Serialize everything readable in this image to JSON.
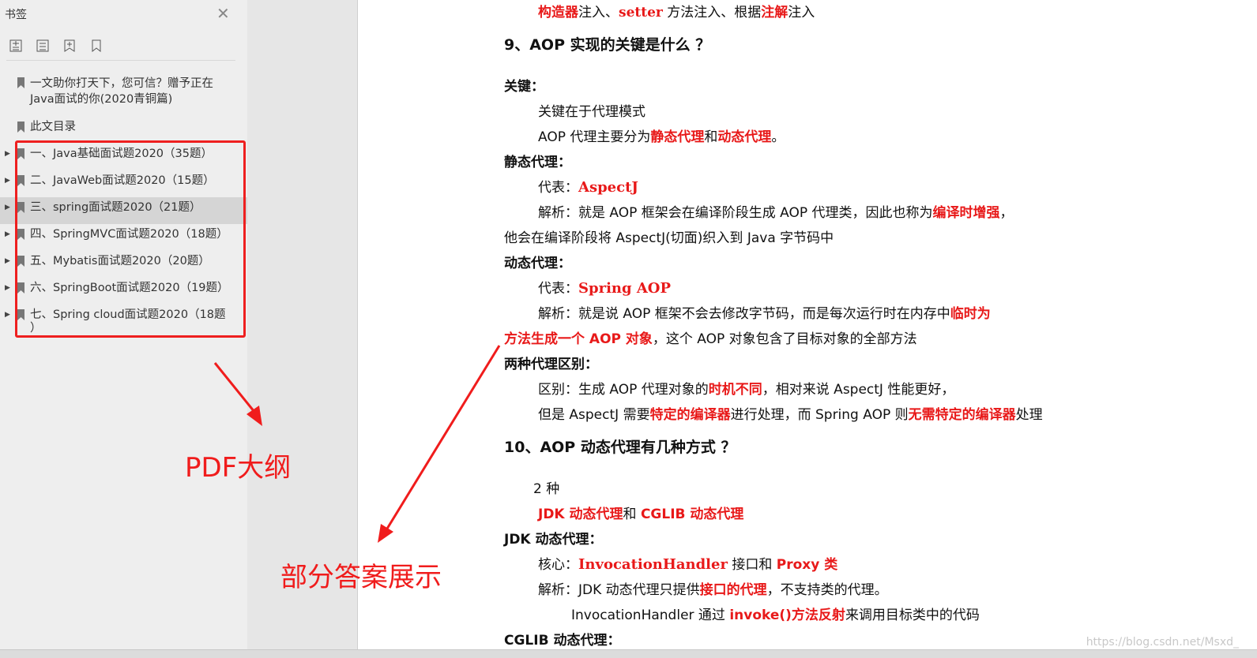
{
  "sidebar": {
    "title": "书签",
    "tools": [
      "expand-all-icon",
      "collapse-all-icon",
      "add-bookmark-icon",
      "bookmark-icon"
    ],
    "items": [
      {
        "label": "一文助你打天下，您可信？赠予正在Java面试的你(2020青铜篇)",
        "has_arrow": false
      },
      {
        "label": "此文目录",
        "has_arrow": false
      },
      {
        "label": "一、Java基础面试题2020（35题）",
        "has_arrow": true
      },
      {
        "label": "二、JavaWeb面试题2020（15题）",
        "has_arrow": true
      },
      {
        "label": "三、spring面试题2020（21题）",
        "has_arrow": true
      },
      {
        "label": "四、SpringMVC面试题2020（18题）",
        "has_arrow": true
      },
      {
        "label": "五、Mybatis面试题2020（20题）",
        "has_arrow": true
      },
      {
        "label": "六、SpringBoot面试题2020（19题）",
        "has_arrow": true
      },
      {
        "label": "七、Spring cloud面试题2020（18题",
        "label_cont": "）",
        "has_arrow": true
      }
    ]
  },
  "annotations": {
    "outline": "PDF大纲",
    "answers": "部分答案展示"
  },
  "doc": {
    "l0a": "构造器",
    "l0b": "注入、",
    "l0c": "setter",
    "l0d": " 方法注入、根据",
    "l0e": "注解",
    "l0f": "注入",
    "q9": "9、AOP 实现的关键是什么 ？",
    "key_h": "关键：",
    "key1": "关键在于代理模式",
    "key2a": "AOP 代理主要分为",
    "key2b": "静态代理",
    "key2c": "和",
    "key2d": "动态代理",
    "key2e": "。",
    "static_h": "静态代理：",
    "s_rep_a": "代表：",
    "s_rep_b": "AspectJ",
    "s_ana_a": "解析：就是 AOP 框架会在编译阶段生成 AOP 代理类，因此也称为",
    "s_ana_b": "编译时增强",
    "s_ana_c": "，",
    "s_ana2": "他会在编译阶段将 AspectJ(切面)织入到 Java 字节码中",
    "dyn_h": "动态代理：",
    "d_rep_a": "代表：",
    "d_rep_b": "Spring AOP",
    "d_ana_a": "解析：就是说 AOP 框架不会去修改字节码，而是每次运行时在内存中",
    "d_ana_b": "临时为",
    "d_ana2a": "方法生成一个 AOP 对象",
    "d_ana2b": "，这个 AOP 对象包含了目标对象的全部方法",
    "diff_h": "两种代理区别：",
    "diff1a": "区别：生成 AOP 代理对象的",
    "diff1b": "时机不同",
    "diff1c": "，相对来说 AspectJ 性能更好，",
    "diff2a": "但是 AspectJ 需要",
    "diff2b": "特定的编译器",
    "diff2c": "进行处理，而 Spring AOP 则",
    "diff2d": "无需特定的编译器",
    "diff2e": "处理",
    "q10": "10、AOP 动态代理有几种方式 ？",
    "two": "2 种",
    "kinds_a": "JDK 动态代理",
    "kinds_b": "和 ",
    "kinds_c": "CGLIB 动态代理",
    "jdk_h": "JDK 动态代理：",
    "core_a": "核心：",
    "core_b": "InvocationHandler",
    "core_c": " 接口和 ",
    "core_d": "Proxy 类",
    "jdk_ana_a": "解析：JDK 动态代理只提供",
    "jdk_ana_b": "接口的代理",
    "jdk_ana_c": "，不支持类的代理。",
    "inv_a": "InvocationHandler  通过 ",
    "inv_b": "invoke()方法反射",
    "inv_c": "来调用目标类中的代码",
    "cglib_h": "CGLIB 动态代理："
  },
  "watermark": "https://blog.csdn.net/Msxd_",
  "colors": {
    "accent_red": "#e81919",
    "sidebar_bg": "#eeeeee",
    "page_bg": "#ffffff"
  }
}
